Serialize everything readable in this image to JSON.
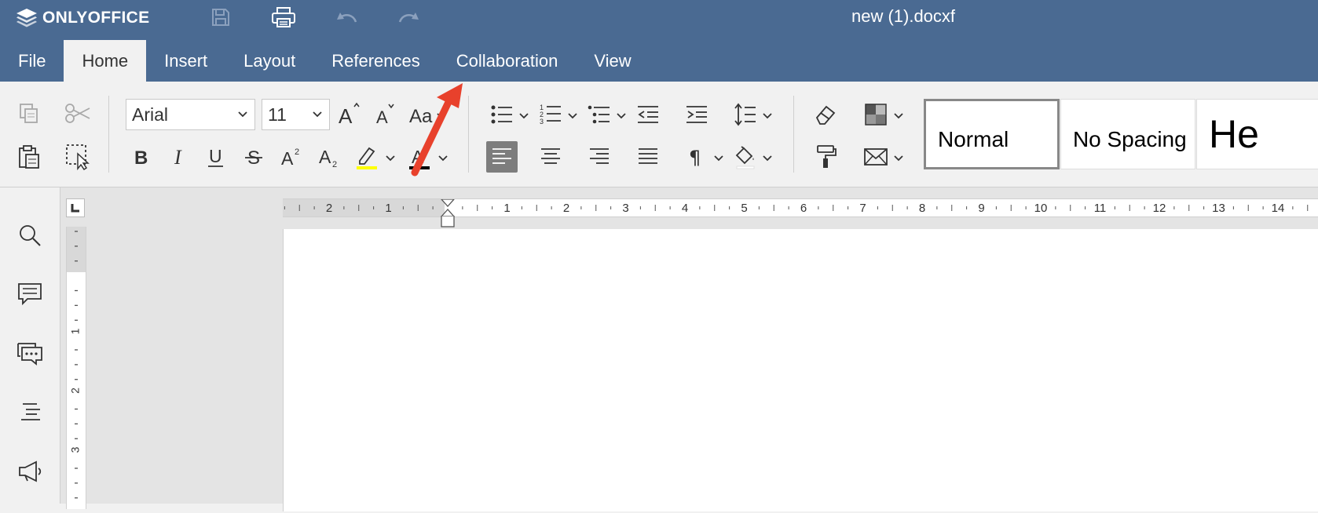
{
  "app": {
    "logo_text": "ONLYOFFICE",
    "document_title": "new (1).docxf"
  },
  "header_icons": [
    "save-icon",
    "print-icon",
    "undo-icon",
    "redo-icon"
  ],
  "tabs": [
    {
      "label": "File",
      "active": false
    },
    {
      "label": "Home",
      "active": true
    },
    {
      "label": "Insert",
      "active": false
    },
    {
      "label": "Layout",
      "active": false
    },
    {
      "label": "References",
      "active": false
    },
    {
      "label": "Collaboration",
      "active": false
    },
    {
      "label": "View",
      "active": false
    }
  ],
  "toolbar": {
    "font_name": "Arial",
    "font_size": "11",
    "highlight_color": "#ffff00",
    "font_color": "#000000",
    "align_active": "align-left"
  },
  "styles": [
    {
      "name": "Normal",
      "selected": true
    },
    {
      "name": "No Spacing",
      "selected": false
    },
    {
      "name": "He",
      "selected": false
    }
  ],
  "left_panel_icons": [
    "search-icon",
    "comments-icon",
    "chat-icon",
    "navigation-icon",
    "feedback-icon"
  ],
  "hruler_labels": [
    "2",
    "1",
    "1",
    "2",
    "3",
    "4",
    "5",
    "6",
    "7",
    "8",
    "9",
    "10",
    "11",
    "12",
    "13",
    "14"
  ],
  "vruler_labels": [
    "1",
    "2",
    "3"
  ],
  "colors": {
    "header": "#4a6a92",
    "toolbar": "#f1f1f1",
    "annotation_arrow": "#e8412c"
  }
}
